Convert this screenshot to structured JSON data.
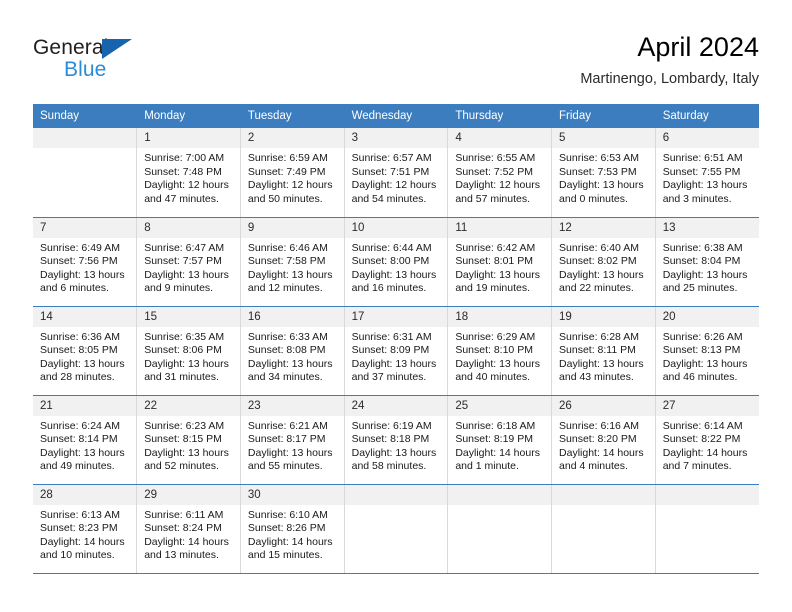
{
  "logo": {
    "word_one": "General",
    "word_two": "Blue",
    "triangle_icon": "triangle-icon",
    "color_dark": "#231f20",
    "color_blue": "#2a8cd6",
    "color_triangle": "#1763ad"
  },
  "header": {
    "title": "April 2024",
    "subtitle": "Martinengo, Lombardy, Italy"
  },
  "theme": {
    "header_bar": "#3b7dbf",
    "daynum_bg": "#f1f1f1",
    "grid_line": "#d9d9d9",
    "row_line": "#3b7dbf"
  },
  "calendar": {
    "weekday_headers": [
      "Sunday",
      "Monday",
      "Tuesday",
      "Wednesday",
      "Thursday",
      "Friday",
      "Saturday"
    ],
    "weeks": [
      [
        {
          "blank": true,
          "day": "",
          "sunrise": "",
          "sunset": "",
          "daylight": ""
        },
        {
          "blank": false,
          "day": "1",
          "sunrise": "Sunrise: 7:00 AM",
          "sunset": "Sunset: 7:48 PM",
          "daylight": "Daylight: 12 hours and 47 minutes."
        },
        {
          "blank": false,
          "day": "2",
          "sunrise": "Sunrise: 6:59 AM",
          "sunset": "Sunset: 7:49 PM",
          "daylight": "Daylight: 12 hours and 50 minutes."
        },
        {
          "blank": false,
          "day": "3",
          "sunrise": "Sunrise: 6:57 AM",
          "sunset": "Sunset: 7:51 PM",
          "daylight": "Daylight: 12 hours and 54 minutes."
        },
        {
          "blank": false,
          "day": "4",
          "sunrise": "Sunrise: 6:55 AM",
          "sunset": "Sunset: 7:52 PM",
          "daylight": "Daylight: 12 hours and 57 minutes."
        },
        {
          "blank": false,
          "day": "5",
          "sunrise": "Sunrise: 6:53 AM",
          "sunset": "Sunset: 7:53 PM",
          "daylight": "Daylight: 13 hours and 0 minutes."
        },
        {
          "blank": false,
          "day": "6",
          "sunrise": "Sunrise: 6:51 AM",
          "sunset": "Sunset: 7:55 PM",
          "daylight": "Daylight: 13 hours and 3 minutes."
        }
      ],
      [
        {
          "blank": false,
          "day": "7",
          "sunrise": "Sunrise: 6:49 AM",
          "sunset": "Sunset: 7:56 PM",
          "daylight": "Daylight: 13 hours and 6 minutes."
        },
        {
          "blank": false,
          "day": "8",
          "sunrise": "Sunrise: 6:47 AM",
          "sunset": "Sunset: 7:57 PM",
          "daylight": "Daylight: 13 hours and 9 minutes."
        },
        {
          "blank": false,
          "day": "9",
          "sunrise": "Sunrise: 6:46 AM",
          "sunset": "Sunset: 7:58 PM",
          "daylight": "Daylight: 13 hours and 12 minutes."
        },
        {
          "blank": false,
          "day": "10",
          "sunrise": "Sunrise: 6:44 AM",
          "sunset": "Sunset: 8:00 PM",
          "daylight": "Daylight: 13 hours and 16 minutes."
        },
        {
          "blank": false,
          "day": "11",
          "sunrise": "Sunrise: 6:42 AM",
          "sunset": "Sunset: 8:01 PM",
          "daylight": "Daylight: 13 hours and 19 minutes."
        },
        {
          "blank": false,
          "day": "12",
          "sunrise": "Sunrise: 6:40 AM",
          "sunset": "Sunset: 8:02 PM",
          "daylight": "Daylight: 13 hours and 22 minutes."
        },
        {
          "blank": false,
          "day": "13",
          "sunrise": "Sunrise: 6:38 AM",
          "sunset": "Sunset: 8:04 PM",
          "daylight": "Daylight: 13 hours and 25 minutes."
        }
      ],
      [
        {
          "blank": false,
          "day": "14",
          "sunrise": "Sunrise: 6:36 AM",
          "sunset": "Sunset: 8:05 PM",
          "daylight": "Daylight: 13 hours and 28 minutes."
        },
        {
          "blank": false,
          "day": "15",
          "sunrise": "Sunrise: 6:35 AM",
          "sunset": "Sunset: 8:06 PM",
          "daylight": "Daylight: 13 hours and 31 minutes."
        },
        {
          "blank": false,
          "day": "16",
          "sunrise": "Sunrise: 6:33 AM",
          "sunset": "Sunset: 8:08 PM",
          "daylight": "Daylight: 13 hours and 34 minutes."
        },
        {
          "blank": false,
          "day": "17",
          "sunrise": "Sunrise: 6:31 AM",
          "sunset": "Sunset: 8:09 PM",
          "daylight": "Daylight: 13 hours and 37 minutes."
        },
        {
          "blank": false,
          "day": "18",
          "sunrise": "Sunrise: 6:29 AM",
          "sunset": "Sunset: 8:10 PM",
          "daylight": "Daylight: 13 hours and 40 minutes."
        },
        {
          "blank": false,
          "day": "19",
          "sunrise": "Sunrise: 6:28 AM",
          "sunset": "Sunset: 8:11 PM",
          "daylight": "Daylight: 13 hours and 43 minutes."
        },
        {
          "blank": false,
          "day": "20",
          "sunrise": "Sunrise: 6:26 AM",
          "sunset": "Sunset: 8:13 PM",
          "daylight": "Daylight: 13 hours and 46 minutes."
        }
      ],
      [
        {
          "blank": false,
          "day": "21",
          "sunrise": "Sunrise: 6:24 AM",
          "sunset": "Sunset: 8:14 PM",
          "daylight": "Daylight: 13 hours and 49 minutes."
        },
        {
          "blank": false,
          "day": "22",
          "sunrise": "Sunrise: 6:23 AM",
          "sunset": "Sunset: 8:15 PM",
          "daylight": "Daylight: 13 hours and 52 minutes."
        },
        {
          "blank": false,
          "day": "23",
          "sunrise": "Sunrise: 6:21 AM",
          "sunset": "Sunset: 8:17 PM",
          "daylight": "Daylight: 13 hours and 55 minutes."
        },
        {
          "blank": false,
          "day": "24",
          "sunrise": "Sunrise: 6:19 AM",
          "sunset": "Sunset: 8:18 PM",
          "daylight": "Daylight: 13 hours and 58 minutes."
        },
        {
          "blank": false,
          "day": "25",
          "sunrise": "Sunrise: 6:18 AM",
          "sunset": "Sunset: 8:19 PM",
          "daylight": "Daylight: 14 hours and 1 minute."
        },
        {
          "blank": false,
          "day": "26",
          "sunrise": "Sunrise: 6:16 AM",
          "sunset": "Sunset: 8:20 PM",
          "daylight": "Daylight: 14 hours and 4 minutes."
        },
        {
          "blank": false,
          "day": "27",
          "sunrise": "Sunrise: 6:14 AM",
          "sunset": "Sunset: 8:22 PM",
          "daylight": "Daylight: 14 hours and 7 minutes."
        }
      ],
      [
        {
          "blank": false,
          "day": "28",
          "sunrise": "Sunrise: 6:13 AM",
          "sunset": "Sunset: 8:23 PM",
          "daylight": "Daylight: 14 hours and 10 minutes."
        },
        {
          "blank": false,
          "day": "29",
          "sunrise": "Sunrise: 6:11 AM",
          "sunset": "Sunset: 8:24 PM",
          "daylight": "Daylight: 14 hours and 13 minutes."
        },
        {
          "blank": false,
          "day": "30",
          "sunrise": "Sunrise: 6:10 AM",
          "sunset": "Sunset: 8:26 PM",
          "daylight": "Daylight: 14 hours and 15 minutes."
        },
        {
          "blank": true,
          "day": "",
          "sunrise": "",
          "sunset": "",
          "daylight": ""
        },
        {
          "blank": true,
          "day": "",
          "sunrise": "",
          "sunset": "",
          "daylight": ""
        },
        {
          "blank": true,
          "day": "",
          "sunrise": "",
          "sunset": "",
          "daylight": ""
        },
        {
          "blank": true,
          "day": "",
          "sunrise": "",
          "sunset": "",
          "daylight": ""
        }
      ]
    ]
  }
}
